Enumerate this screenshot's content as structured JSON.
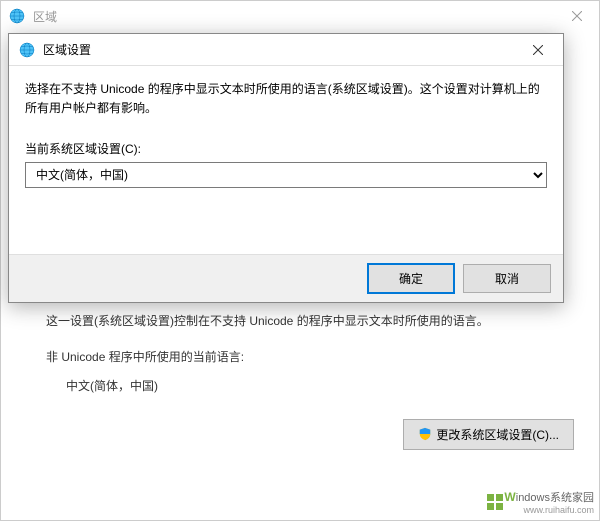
{
  "parent": {
    "title": "区域",
    "desc": "这一设置(系统区域设置)控制在不支持 Unicode 的程序中显示文本时所使用的语言。",
    "current_label": "非 Unicode 程序中所使用的当前语言:",
    "current_locale": "中文(简体，中国)",
    "change_button": "更改系统区域设置(C)..."
  },
  "modal": {
    "title": "区域设置",
    "desc": "选择在不支持 Unicode 的程序中显示文本时所使用的语言(系统区域设置)。这个设置对计算机上的所有用户帐户都有影响。",
    "select_label": "当前系统区域设置(C):",
    "select_value": "中文(简体，中国)",
    "ok": "确定",
    "cancel": "取消"
  },
  "watermark": {
    "letter": "W",
    "text": "indows系统家园",
    "url": "www.ruihaifu.com"
  }
}
